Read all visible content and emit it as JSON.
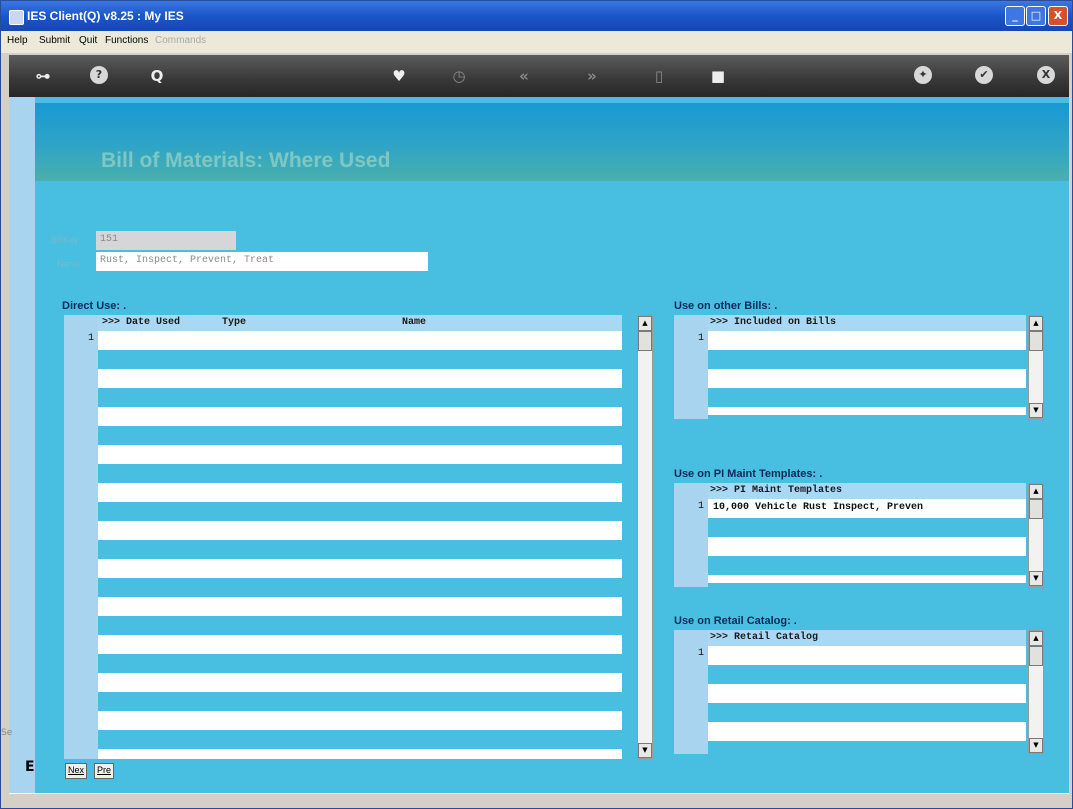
{
  "window": {
    "title": "IES Client(Q) v8.25 : My IES",
    "min_label": "_",
    "max_label": "□",
    "close_label": "X"
  },
  "menu": {
    "items": [
      "Help",
      "Submit",
      "Quit",
      "Functions"
    ],
    "disabled": "Commands"
  },
  "toolbar": {
    "icons": [
      "key-icon",
      "help-icon",
      "search-icon",
      "favorite-icon",
      "clock-icon",
      "rewind-icon",
      "fast-forward-icon",
      "save-icon",
      "stop-icon",
      "settings-icon",
      "ok-icon",
      "close-icon"
    ],
    "glyphs": {
      "key": "⊶",
      "help": "?",
      "search": "Q",
      "favorite": "♥",
      "clock": "◷",
      "rewind": "«",
      "ffwd": "»",
      "save": "▯",
      "stop": "■",
      "settings": "✦",
      "ok": "✔",
      "close": "X"
    }
  },
  "page": {
    "title": "Bill of Materials: Where Used"
  },
  "fields": {
    "billkey_label": "BillKey",
    "billkey_value": "151",
    "name_label": "Name",
    "name_value": "Rust, Inspect, Prevent, Treat"
  },
  "direct_use": {
    "title": "Direct Use: .",
    "headers": [
      ">>> Date Used",
      "Type",
      "Name"
    ],
    "rows": [
      {
        "num": "1",
        "text": ""
      }
    ]
  },
  "other_bills": {
    "title": "Use on other Bills: .",
    "header": ">>> Included on Bills",
    "rows": [
      {
        "num": "1",
        "text": ""
      }
    ]
  },
  "pi_templates": {
    "title": "Use on PI Maint Templates: .",
    "header": ">>> PI Maint Templates",
    "rows": [
      {
        "num": "1",
        "text": "10,000 Vehicle Rust Inspect, Preven"
      }
    ]
  },
  "retail": {
    "title": "Use on Retail Catalog: .",
    "header": ">>> Retail Catalog",
    "rows": [
      {
        "num": "1",
        "text": ""
      }
    ]
  },
  "scroll": {
    "up": "▲",
    "down": "▼"
  },
  "pager": {
    "next": "Nex",
    "prev": "Pre"
  },
  "side": {
    "tag": "Se",
    "letter": "E"
  }
}
